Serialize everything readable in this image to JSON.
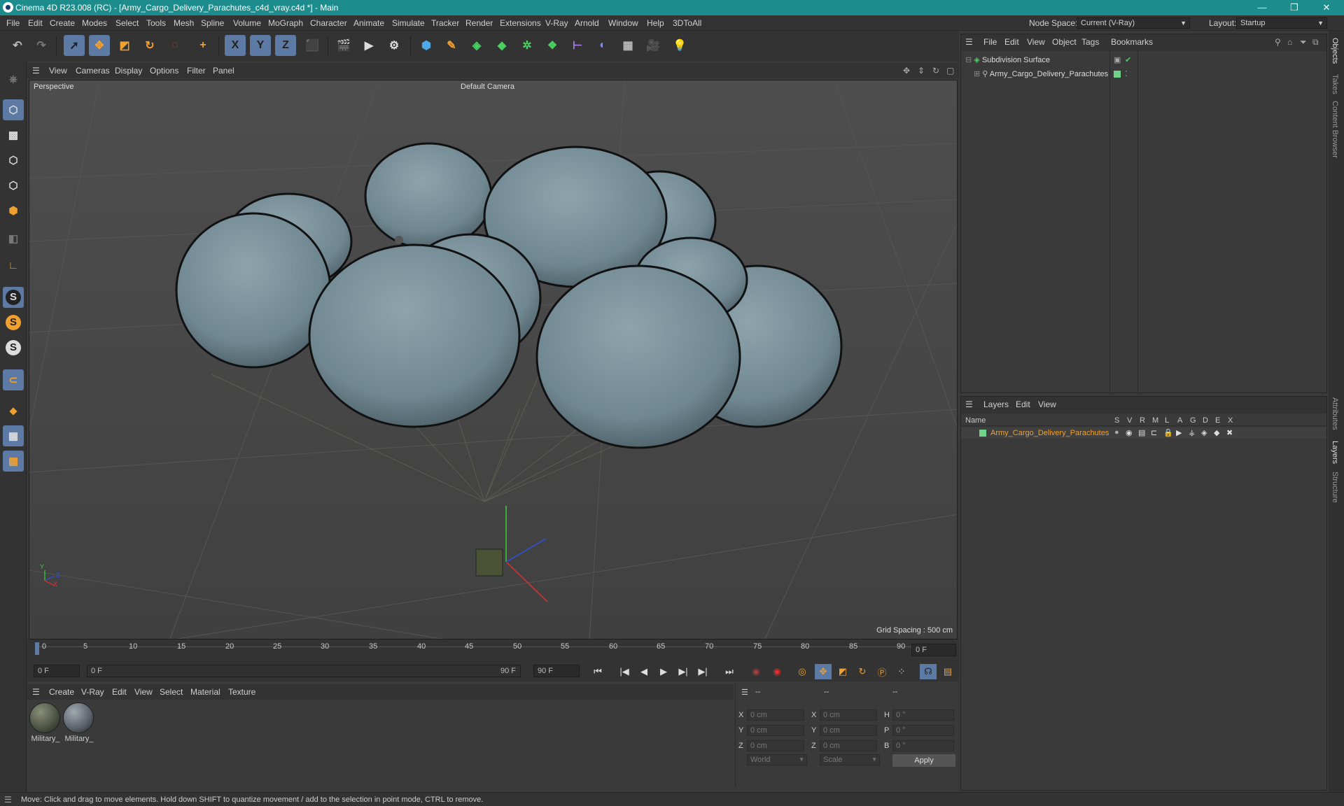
{
  "titlebar": {
    "title": "Cinema 4D R23.008 (RC) - [Army_Cargo_Delivery_Parachutes_c4d_vray.c4d *] - Main",
    "min": "—",
    "max": "❐",
    "close": "✕"
  },
  "menubar": {
    "items": [
      "File",
      "Edit",
      "Create",
      "Modes",
      "Select",
      "Tools",
      "Mesh",
      "Spline",
      "Volume",
      "MoGraph",
      "Character",
      "Animate",
      "Simulate",
      "Tracker",
      "Render",
      "Extensions",
      "V-Ray",
      "Arnold",
      "Window",
      "Help",
      "3DToAll"
    ],
    "node_space_label": "Node Space:",
    "node_space_value": "Current (V-Ray)",
    "layout_label": "Layout:",
    "layout_value": "Startup"
  },
  "toolbar": {
    "icons": [
      "undo-icon",
      "redo-icon",
      "select-icon",
      "move-icon",
      "scale-icon",
      "rotate-icon",
      "recent-tools-icon",
      "live-select-icon",
      "x-axis-lock-icon",
      "y-axis-lock-icon",
      "z-axis-lock-icon",
      "coordinate-system-icon",
      "render-view-icon",
      "render-picture-viewer-icon",
      "render-settings-icon",
      "cube-icon",
      "pen-icon",
      "subdivision-icon",
      "extrude-icon",
      "cloner-icon",
      "array-icon",
      "symmetry-icon",
      "deformer-icon",
      "floor-icon",
      "camera-icon",
      "light-icon"
    ],
    "x_label": "X",
    "y_label": "Y",
    "z_label": "Z"
  },
  "leftbar": {
    "icons": [
      "make-editable-icon",
      "model-mode-icon",
      "texture-mode-icon",
      "points-mode-icon",
      "edges-mode-icon",
      "polygons-mode-icon",
      "uv-mode-icon",
      "axis-mode-icon",
      "snap-icon",
      "snap-settings-icon",
      "quantize-icon",
      "magnet-icon",
      "workplane-icon",
      "grid-icon",
      "locked-workplane-icon"
    ],
    "snap_letter": "S"
  },
  "viewport": {
    "menu": [
      "View",
      "Cameras",
      "Display",
      "Options",
      "Filter",
      "Panel"
    ],
    "label": "Perspective",
    "camera": "Default Camera",
    "grid_spacing": "Grid Spacing : 500 cm",
    "axis_x": "X",
    "axis_y": "Y",
    "axis_z": "Z"
  },
  "timeline": {
    "ticks": [
      "0",
      "5",
      "10",
      "15",
      "20",
      "25",
      "30",
      "35",
      "40",
      "45",
      "50",
      "55",
      "60",
      "65",
      "70",
      "75",
      "80",
      "85",
      "90"
    ],
    "current_frame": "0 F",
    "start_field": "0 F",
    "range_start": "0 F",
    "range_end": "90 F",
    "end_field": "90 F"
  },
  "material_manager": {
    "menu": [
      "Create",
      "V-Ray",
      "Edit",
      "View",
      "Select",
      "Material",
      "Texture"
    ],
    "materials": [
      {
        "label": "Military_",
        "color": "#4a5040"
      },
      {
        "label": "Military_",
        "color": "#5a6068"
      }
    ]
  },
  "coords": {
    "header": [
      "--",
      "--",
      "--"
    ],
    "rows": [
      {
        "a": "X",
        "a_val": "0 cm",
        "b": "X",
        "b_val": "0 cm",
        "c": "H",
        "c_val": "0 °"
      },
      {
        "a": "Y",
        "a_val": "0 cm",
        "b": "Y",
        "b_val": "0 cm",
        "c": "P",
        "c_val": "0 °"
      },
      {
        "a": "Z",
        "a_val": "0 cm",
        "b": "Z",
        "b_val": "0 cm",
        "c": "B",
        "c_val": "0 °"
      }
    ],
    "space": "World",
    "mode": "Scale",
    "apply": "Apply"
  },
  "objects_panel": {
    "menu": [
      "File",
      "Edit",
      "View",
      "Object",
      "Tags",
      "Bookmarks"
    ],
    "items": [
      {
        "name": "Subdivision Surface"
      },
      {
        "name": "Army_Cargo_Delivery_Parachutes"
      }
    ]
  },
  "layers_panel": {
    "menu": [
      "Layers",
      "Edit",
      "View"
    ],
    "columns": [
      "Name",
      "S",
      "V",
      "R",
      "M",
      "L",
      "A",
      "G",
      "D",
      "E",
      "X"
    ],
    "layers": [
      {
        "name": "Army_Cargo_Delivery_Parachutes",
        "color": "#6fd38a"
      }
    ]
  },
  "right_tabs": [
    "Objects",
    "Takes",
    "Content Browser",
    "Attributes",
    "Layers",
    "Structure"
  ],
  "status": {
    "text": "Move: Click and drag to move elements. Hold down SHIFT to quantize movement / add to the selection in point mode, CTRL to remove."
  },
  "colors": {
    "titlebar": "#1d8c8c",
    "accent": "#5c7aa3",
    "layer_highlight": "#f0a030",
    "parachute": "#6f8791"
  }
}
